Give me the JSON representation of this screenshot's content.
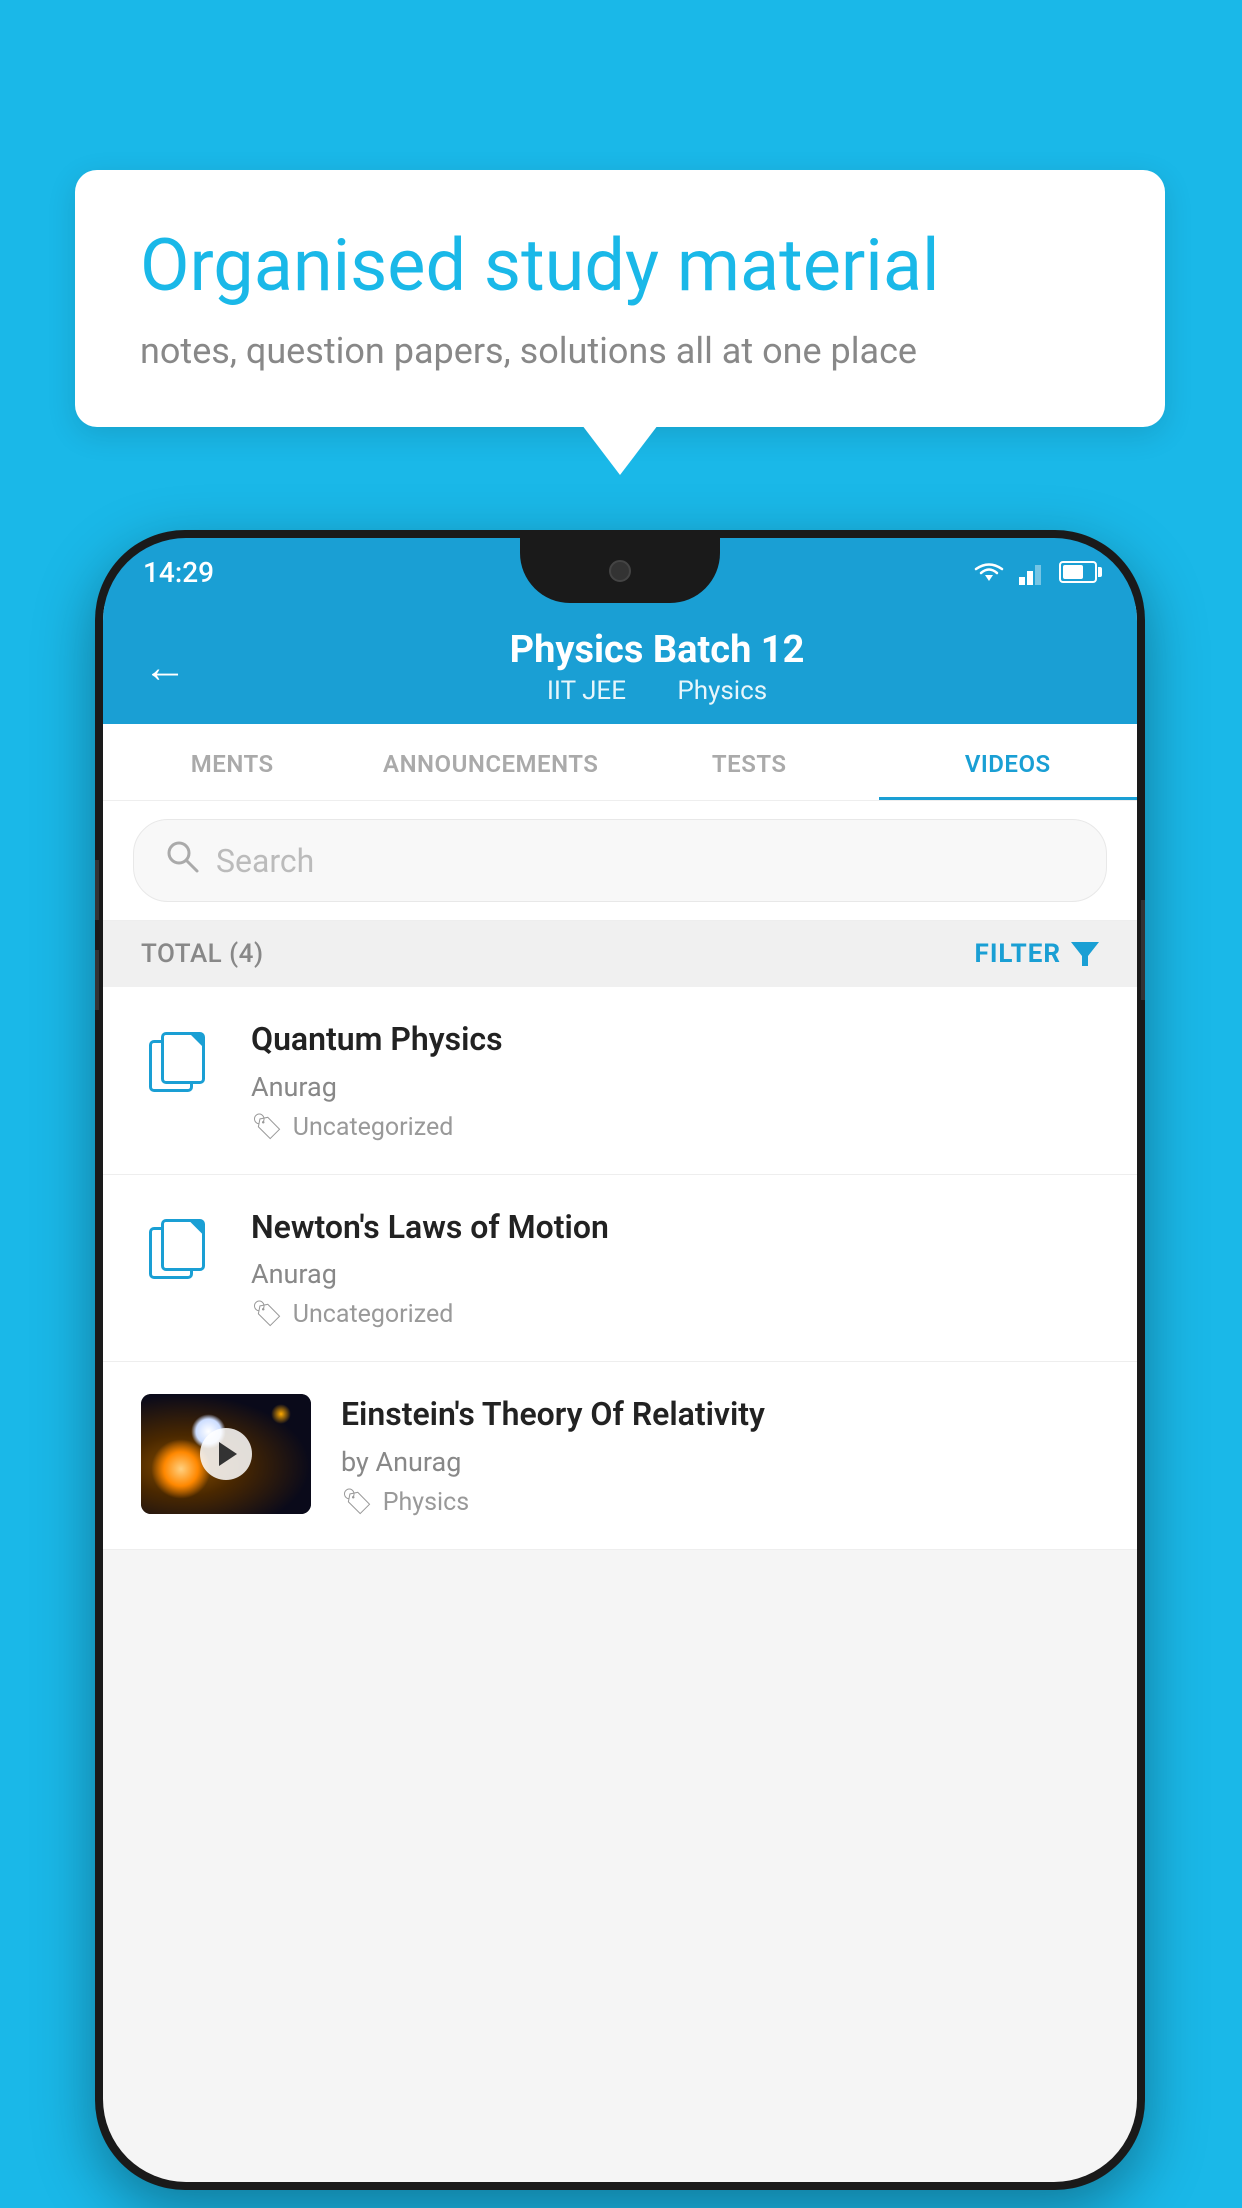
{
  "background_color": "#1ab8e8",
  "bubble": {
    "title": "Organised study material",
    "subtitle": "notes, question papers, solutions all at one place"
  },
  "phone": {
    "status": {
      "time": "14:29"
    },
    "header": {
      "title": "Physics Batch 12",
      "subtitle_left": "IIT JEE",
      "subtitle_right": "Physics"
    },
    "tabs": [
      {
        "label": "MENTS",
        "active": false
      },
      {
        "label": "ANNOUNCEMENTS",
        "active": false
      },
      {
        "label": "TESTS",
        "active": false
      },
      {
        "label": "VIDEOS",
        "active": true
      }
    ],
    "search": {
      "placeholder": "Search"
    },
    "filter": {
      "total_label": "TOTAL (4)",
      "filter_label": "FILTER"
    },
    "videos": [
      {
        "title": "Quantum Physics",
        "author": "Anurag",
        "tag": "Uncategorized",
        "type": "file"
      },
      {
        "title": "Newton's Laws of Motion",
        "author": "Anurag",
        "tag": "Uncategorized",
        "type": "file"
      },
      {
        "title": "Einstein's Theory Of Relativity",
        "author": "by Anurag",
        "tag": "Physics",
        "type": "video"
      }
    ]
  }
}
